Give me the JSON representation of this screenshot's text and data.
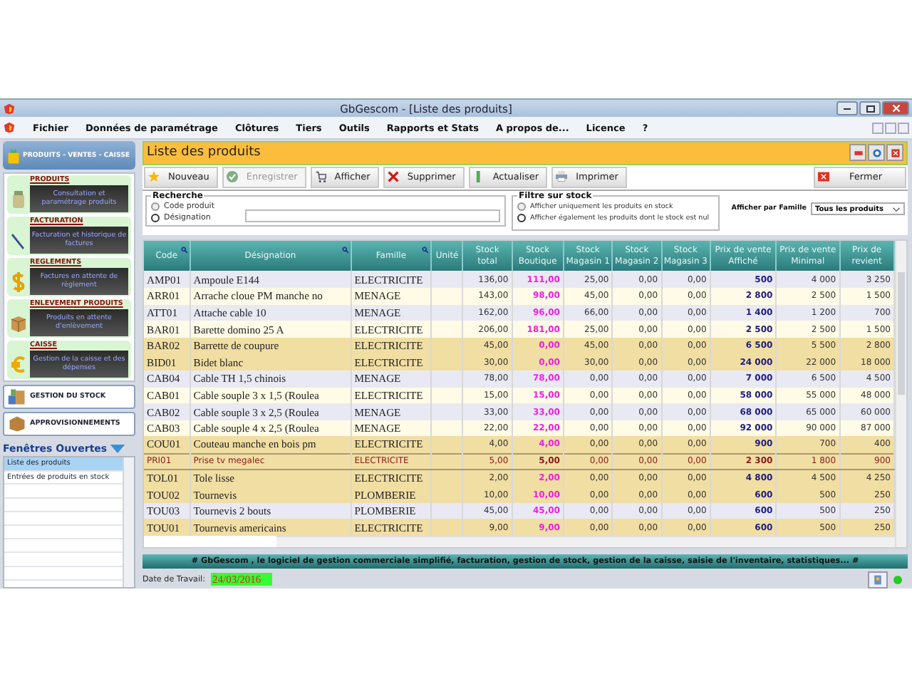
{
  "window": {
    "title": "GbGescom - [Liste des produits]"
  },
  "menu": [
    "Fichier",
    "Données de paramétrage",
    "Clôtures",
    "Tiers",
    "Outils",
    "Rapports et Stats",
    "A propos de...",
    "Licence",
    "?"
  ],
  "sidebar": {
    "module": "PRODUITS - VENTES - CAISSE",
    "sections": [
      {
        "title": "PRODUITS",
        "action": "Consultation et paramétrage produits"
      },
      {
        "title": "FACTURATION",
        "action": "Facturation et historique de factures"
      },
      {
        "title": "REGLEMENTS",
        "action": "Factures en attente de règlement"
      },
      {
        "title": "ENLEVEMENT PRODUITS",
        "action": "Produits en attente d'enlèvement"
      },
      {
        "title": "CAISSE",
        "action": "Gestion de la caisse et des dépenses"
      }
    ],
    "modules": [
      "GESTION DU STOCK",
      "APPROVISIONNEMENTS"
    ],
    "open_windows": {
      "title": "Fenêtres Ouvertes",
      "items": [
        {
          "label": "Liste des produits",
          "selected": true
        },
        {
          "label": "Entrées de produits en stock",
          "selected": false
        }
      ]
    }
  },
  "page": {
    "title": "Liste des produits"
  },
  "toolbar": [
    {
      "label": "Nouveau",
      "disabled": false
    },
    {
      "label": "Enregistrer",
      "disabled": true
    },
    {
      "label": "Afficher",
      "disabled": false
    },
    {
      "label": "Supprimer",
      "disabled": false
    },
    {
      "label": "Actualiser",
      "disabled": false
    },
    {
      "label": "Imprimer",
      "disabled": false
    }
  ],
  "close_button": "Fermer",
  "search": {
    "title": "Recherche",
    "options": [
      {
        "label": "Code produit",
        "selected": false
      },
      {
        "label": "Désignation",
        "selected": true
      }
    ]
  },
  "stock_filter": {
    "title": "Filtre sur stock",
    "options": [
      {
        "label": "Afficher uniquement les produits en stock",
        "selected": false
      },
      {
        "label": "Afficher également les produits dont le stock est nul",
        "selected": true
      }
    ]
  },
  "family_filter": {
    "label": "Afficher par Famille",
    "value": "Tous les produits"
  },
  "table": {
    "columns": [
      {
        "lines": [
          "Code"
        ],
        "searchable": true
      },
      {
        "lines": [
          "Désignation"
        ],
        "searchable": true
      },
      {
        "lines": [
          "Famille"
        ],
        "searchable": true
      },
      {
        "lines": [
          "Unité"
        ],
        "searchable": false
      },
      {
        "lines": [
          "Stock",
          "total"
        ],
        "searchable": false
      },
      {
        "lines": [
          "Stock",
          "Boutique"
        ],
        "searchable": false
      },
      {
        "lines": [
          "Stock",
          "Magasin 1"
        ],
        "searchable": false
      },
      {
        "lines": [
          "Stock",
          "Magasin 2"
        ],
        "searchable": false
      },
      {
        "lines": [
          "Stock",
          "Magasin 3"
        ],
        "searchable": false
      },
      {
        "lines": [
          "Prix de vente",
          "Affiché"
        ],
        "searchable": false
      },
      {
        "lines": [
          "Prix de vente",
          "Minimal"
        ],
        "searchable": false
      },
      {
        "lines": [
          "Prix de",
          "revient"
        ],
        "searchable": false
      }
    ],
    "rows": [
      {
        "code": "AMP01",
        "designation": "Ampoule  E144",
        "famille": "ELECTRICITE",
        "stock_total": "136,00",
        "boutique": "111,00",
        "magasin_1": "25,00",
        "magasin_2": "0,00",
        "magasin_3": "0,00",
        "prix_affiche": "500",
        "prix_minimal": "4 000",
        "prix_revient": "3 250",
        "low_stock": false,
        "selected": false
      },
      {
        "code": "ARR01",
        "designation": "Arrache cloue PM manche no",
        "famille": "MENAGE",
        "stock_total": "143,00",
        "boutique": "98,00",
        "magasin_1": "45,00",
        "magasin_2": "0,00",
        "magasin_3": "0,00",
        "prix_affiche": "2 800",
        "prix_minimal": "2 500",
        "prix_revient": "1 500",
        "low_stock": false,
        "selected": false
      },
      {
        "code": "ATT01",
        "designation": "Attache cable 10",
        "famille": "MENAGE",
        "stock_total": "162,00",
        "boutique": "96,00",
        "magasin_1": "66,00",
        "magasin_2": "0,00",
        "magasin_3": "0,00",
        "prix_affiche": "1 400",
        "prix_minimal": "1 200",
        "prix_revient": "700",
        "low_stock": false,
        "selected": false
      },
      {
        "code": "BAR01",
        "designation": "Barette domino 25 A",
        "famille": "ELECTRICITE",
        "stock_total": "206,00",
        "boutique": "181,00",
        "magasin_1": "25,00",
        "magasin_2": "0,00",
        "magasin_3": "0,00",
        "prix_affiche": "2 500",
        "prix_minimal": "2 500",
        "prix_revient": "1 500",
        "low_stock": false,
        "selected": false
      },
      {
        "code": "BAR02",
        "designation": "Barrette de coupure",
        "famille": "ELECTRICITE",
        "stock_total": "45,00",
        "boutique": "0,00",
        "magasin_1": "45,00",
        "magasin_2": "0,00",
        "magasin_3": "0,00",
        "prix_affiche": "6 500",
        "prix_minimal": "5 500",
        "prix_revient": "2 800",
        "low_stock": true,
        "selected": false
      },
      {
        "code": "BID01",
        "designation": "Bidet blanc",
        "famille": "ELECTRICITE",
        "stock_total": "30,00",
        "boutique": "0,00",
        "magasin_1": "30,00",
        "magasin_2": "0,00",
        "magasin_3": "0,00",
        "prix_affiche": "24 000",
        "prix_minimal": "22 000",
        "prix_revient": "18 000",
        "low_stock": true,
        "selected": false
      },
      {
        "code": "CAB04",
        "designation": "Cable TH 1,5 chinois",
        "famille": "MENAGE",
        "stock_total": "78,00",
        "boutique": "78,00",
        "magasin_1": "0,00",
        "magasin_2": "0,00",
        "magasin_3": "0,00",
        "prix_affiche": "7 000",
        "prix_minimal": "6 500",
        "prix_revient": "4 500",
        "low_stock": false,
        "selected": false
      },
      {
        "code": "CAB01",
        "designation": "Cable souple 3 x 1,5 (Roulea",
        "famille": "ELECTRICITE",
        "stock_total": "15,00",
        "boutique": "15,00",
        "magasin_1": "0,00",
        "magasin_2": "0,00",
        "magasin_3": "0,00",
        "prix_affiche": "58 000",
        "prix_minimal": "55 000",
        "prix_revient": "48 000",
        "low_stock": false,
        "selected": false
      },
      {
        "code": "CAB02",
        "designation": "Cable souple 3 x 2,5 (Roulea",
        "famille": "MENAGE",
        "stock_total": "33,00",
        "boutique": "33,00",
        "magasin_1": "0,00",
        "magasin_2": "0,00",
        "magasin_3": "0,00",
        "prix_affiche": "68 000",
        "prix_minimal": "65 000",
        "prix_revient": "60 000",
        "low_stock": false,
        "selected": false
      },
      {
        "code": "CAB03",
        "designation": "Cable souple 4 x 2,5 (Roulea",
        "famille": "MENAGE",
        "stock_total": "22,00",
        "boutique": "22,00",
        "magasin_1": "0,00",
        "magasin_2": "0,00",
        "magasin_3": "0,00",
        "prix_affiche": "92 000",
        "prix_minimal": "90 000",
        "prix_revient": "87 000",
        "low_stock": false,
        "selected": false
      },
      {
        "code": "COU01",
        "designation": "Couteau manche en bois pm",
        "famille": "ELECTRICITE",
        "stock_total": "4,00",
        "boutique": "4,00",
        "magasin_1": "0,00",
        "magasin_2": "0,00",
        "magasin_3": "0,00",
        "prix_affiche": "900",
        "prix_minimal": "700",
        "prix_revient": "400",
        "low_stock": true,
        "selected": false
      },
      {
        "code": "PRI01",
        "designation": "Prise tv megalec",
        "famille": "ELECTRICITE",
        "stock_total": "5,00",
        "boutique": "5,00",
        "magasin_1": "0,00",
        "magasin_2": "0,00",
        "magasin_3": "0,00",
        "prix_affiche": "2 300",
        "prix_minimal": "1 800",
        "prix_revient": "900",
        "low_stock": true,
        "selected": true
      },
      {
        "code": "TOL01",
        "designation": "Tole lisse",
        "famille": "ELECTRICITE",
        "stock_total": "2,00",
        "boutique": "2,00",
        "magasin_1": "0,00",
        "magasin_2": "0,00",
        "magasin_3": "0,00",
        "prix_affiche": "4 800",
        "prix_minimal": "4 500",
        "prix_revient": "4 250",
        "low_stock": true,
        "selected": false
      },
      {
        "code": "TOU02",
        "designation": "Tournevis",
        "famille": "PLOMBERIE",
        "stock_total": "10,00",
        "boutique": "10,00",
        "magasin_1": "0,00",
        "magasin_2": "0,00",
        "magasin_3": "0,00",
        "prix_affiche": "600",
        "prix_minimal": "500",
        "prix_revient": "250",
        "low_stock": true,
        "selected": false
      },
      {
        "code": "TOU03",
        "designation": "Tournevis 2 bouts",
        "famille": "PLOMBERIE",
        "stock_total": "45,00",
        "boutique": "45,00",
        "magasin_1": "0,00",
        "magasin_2": "0,00",
        "magasin_3": "0,00",
        "prix_affiche": "600",
        "prix_minimal": "500",
        "prix_revient": "250",
        "low_stock": false,
        "selected": false
      },
      {
        "code": "TOU01",
        "designation": "Tournevis americains",
        "famille": "ELECTRICITE",
        "stock_total": "9,00",
        "boutique": "9,00",
        "magasin_1": "0,00",
        "magasin_2": "0,00",
        "magasin_3": "0,00",
        "prix_affiche": "600",
        "prix_minimal": "500",
        "prix_revient": "250",
        "low_stock": true,
        "selected": false
      }
    ]
  },
  "banner": "#   GbGescom , le logiciel de gestion commerciale simplifié, facturation, gestion de stock, gestion de la caisse, saisie de l'inventaire, statistiques... #",
  "status": {
    "date_label": "Date de Travail:",
    "date": "24/03/2016"
  }
}
